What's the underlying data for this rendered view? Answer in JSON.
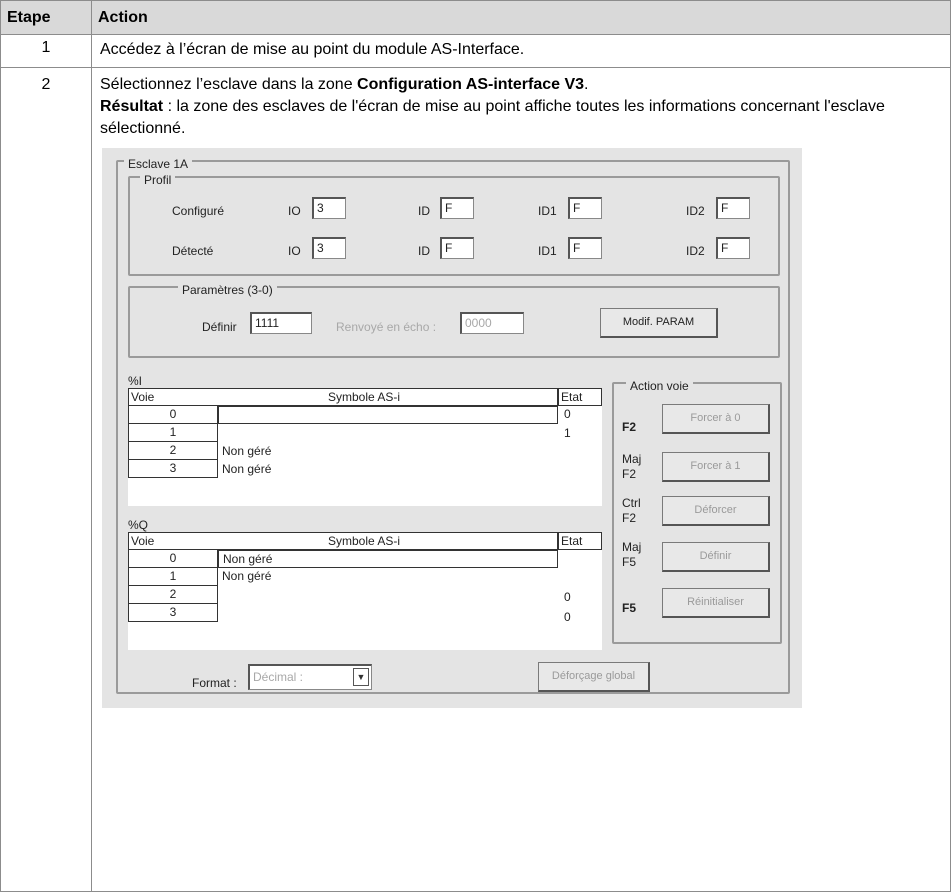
{
  "table": {
    "headers": {
      "step": "Etape",
      "action": "Action"
    },
    "rows": [
      {
        "step": "1",
        "text": "Accédez à l’écran de mise au point du module AS-Interface."
      },
      {
        "step": "2",
        "line1_a": "Sélectionnez l’esclave dans la zone ",
        "line1_b": "Configuration AS-interface V3",
        "line1_c": ".",
        "line2_b": "Résultat",
        "line2_a": " : la zone des esclaves de l'écran de mise au point affiche toutes les informations concernant l'esclave sélectionné."
      }
    ]
  },
  "panel": {
    "title": "Esclave 1A",
    "profil": {
      "title": "Profil",
      "configure_label": "Configuré",
      "detecte_label": "Détecté",
      "io_label": "IO",
      "id_label": "ID",
      "id1_label": "ID1",
      "id2_label": "ID2",
      "configure": {
        "io": "3",
        "id": "F",
        "id1": "F",
        "id2": "F"
      },
      "detecte": {
        "io": "3",
        "id": "F",
        "id1": "F",
        "id2": "F"
      }
    },
    "params": {
      "title": "Paramètres (3-0)",
      "definir_label": "Définir",
      "definir_value": "1111",
      "echo_label": "Renvoyé en écho :",
      "echo_value": "0000",
      "modif_button": "Modif. PARAM"
    },
    "inputs": {
      "title": "%I",
      "col_voie": "Voie",
      "col_symbole": "Symbole AS-i",
      "col_etat": "Etat",
      "rows": [
        {
          "voie": "0",
          "symbole": "",
          "etat": "0"
        },
        {
          "voie": "1",
          "symbole": "",
          "etat": "1"
        },
        {
          "voie": "2",
          "symbole": "Non géré",
          "etat": ""
        },
        {
          "voie": "3",
          "symbole": "Non géré",
          "etat": ""
        }
      ]
    },
    "outputs": {
      "title": "%Q",
      "col_voie": "Voie",
      "col_symbole": "Symbole AS-i",
      "col_etat": "Etat",
      "rows": [
        {
          "voie": "0",
          "symbole": "Non géré",
          "etat": ""
        },
        {
          "voie": "1",
          "symbole": "Non géré",
          "etat": ""
        },
        {
          "voie": "2",
          "symbole": "",
          "etat": "0"
        },
        {
          "voie": "3",
          "symbole": "",
          "etat": "0"
        }
      ]
    },
    "action_voie": {
      "title": "Action voie",
      "items": [
        {
          "key": "F2",
          "button": "Forcer à 0"
        },
        {
          "key": "Maj F2",
          "button": "Forcer à 1"
        },
        {
          "key": "Ctrl F2",
          "button": "Déforcer"
        },
        {
          "key": "Maj F5",
          "button": "Définir"
        },
        {
          "key": "F5",
          "button": "Réinitialiser"
        }
      ]
    },
    "format_label": "Format :",
    "format_value": "Décimal :",
    "global_button": "Déforçage global"
  }
}
